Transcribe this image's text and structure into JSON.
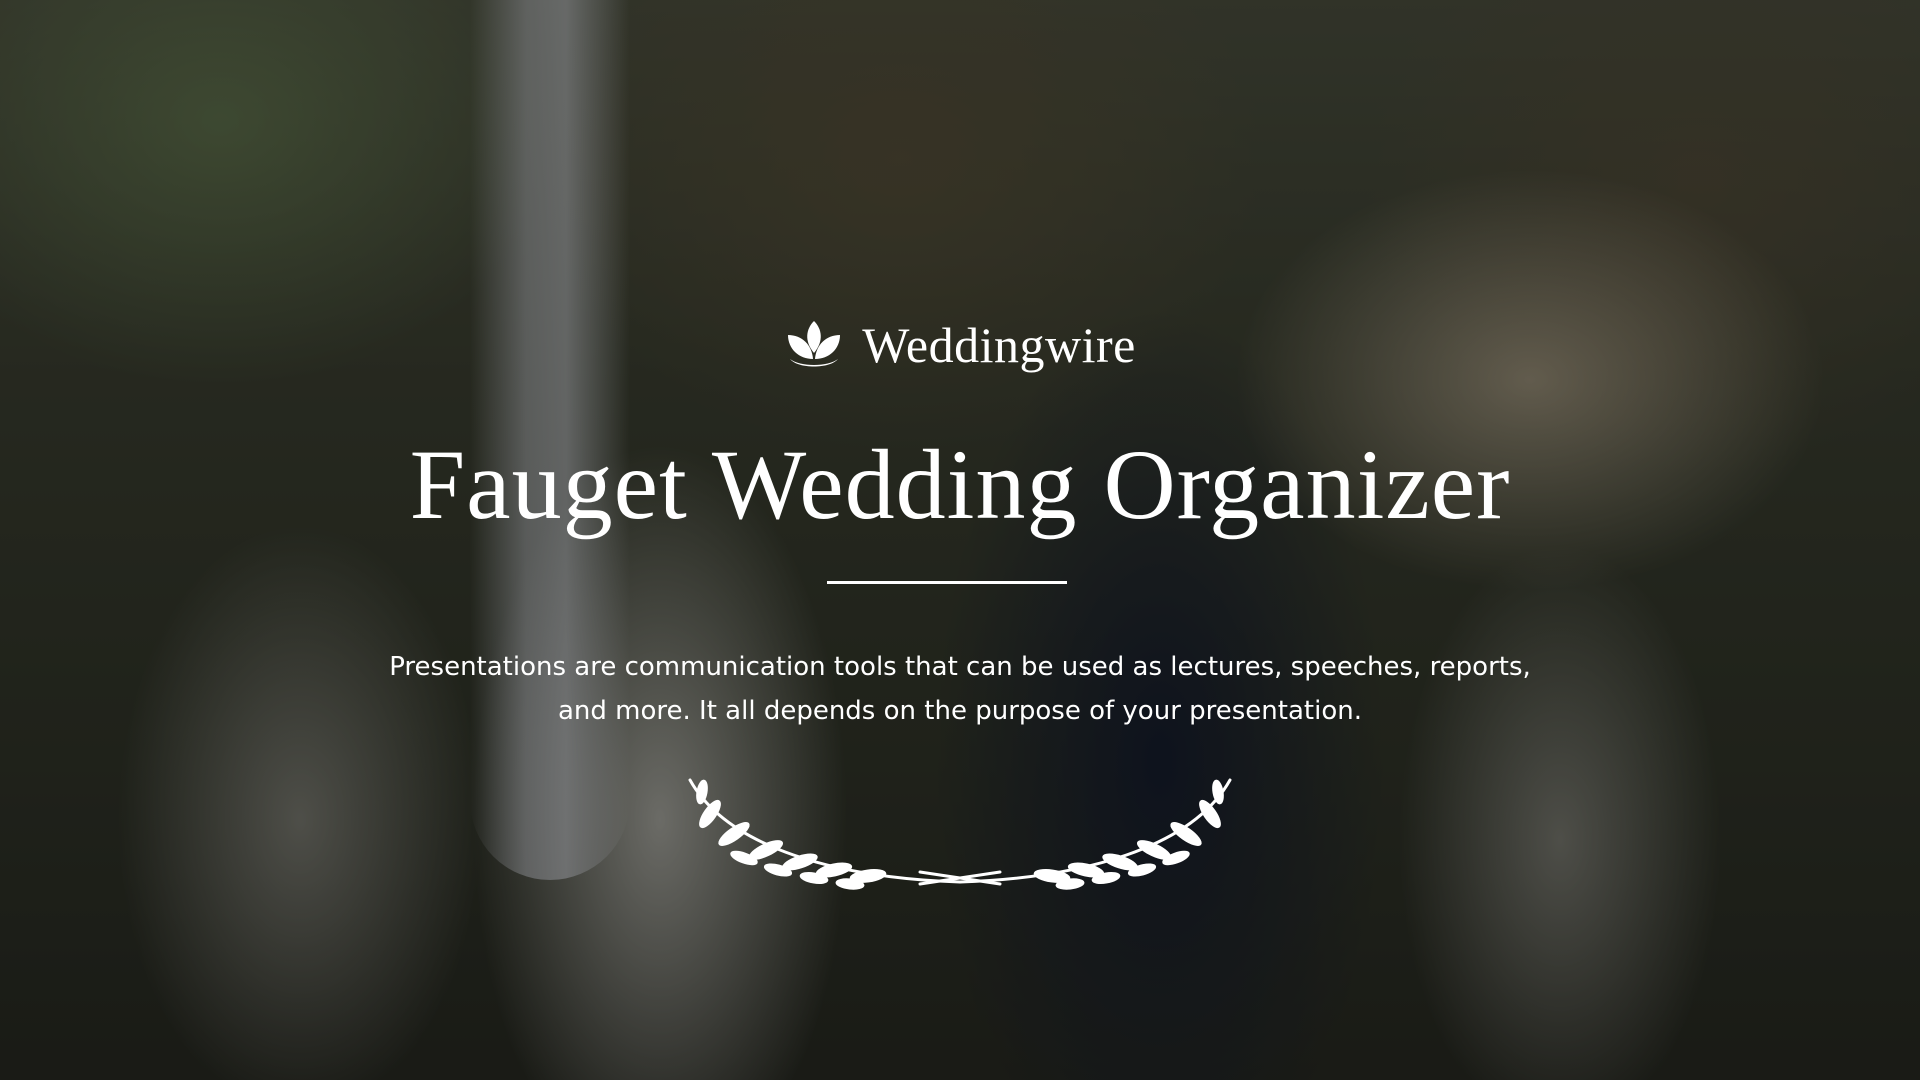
{
  "slide": {
    "brand": {
      "name": "Weddingwire",
      "icon": "lotus-icon"
    },
    "title": "Fauget Wedding Organizer",
    "description_line1": "Presentations are communication tools that can be used as lectures, speeches, reports,",
    "description_line2": "and more. It all depends on the purpose of your presentation.",
    "ornament": "laurel-icon",
    "colors": {
      "text": "#ffffff",
      "overlay": "rgba(0,0,0,0.38)"
    }
  }
}
